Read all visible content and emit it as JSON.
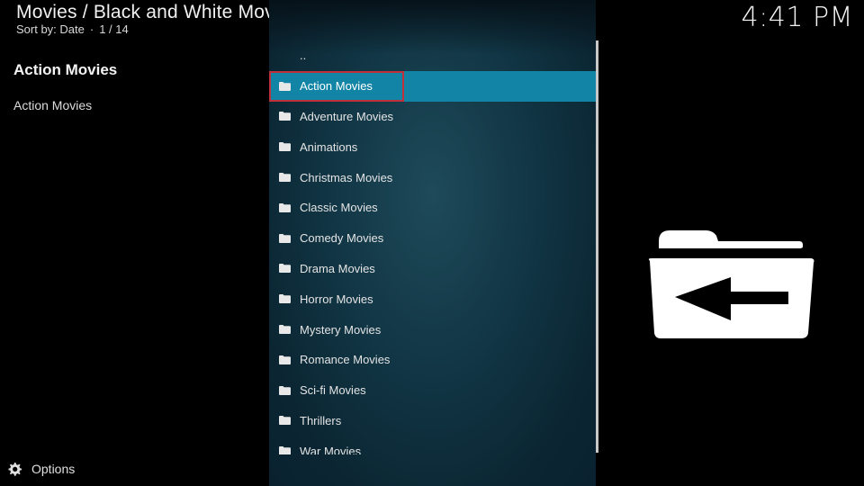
{
  "header": {
    "title": "Movies / Black and White Movies",
    "sort_label": "Sort by: Date",
    "separator": "·",
    "position": "1 / 14",
    "clock": "4:41 PM"
  },
  "info_panel": {
    "title": "Action Movies",
    "text": "Action Movies"
  },
  "list": {
    "parent_label": "..",
    "items": [
      {
        "label": "Action Movies",
        "selected": true
      },
      {
        "label": "Adventure Movies"
      },
      {
        "label": "Animations"
      },
      {
        "label": "Christmas Movies"
      },
      {
        "label": "Classic Movies"
      },
      {
        "label": "Comedy Movies"
      },
      {
        "label": "Drama Movies"
      },
      {
        "label": "Horror Movies"
      },
      {
        "label": "Mystery Movies"
      },
      {
        "label": "Romance Movies"
      },
      {
        "label": "Sci-fi Movies"
      },
      {
        "label": "Thrillers"
      },
      {
        "label": "War Movies"
      }
    ]
  },
  "footer": {
    "options_label": "Options"
  },
  "icons": {
    "folder": "folder-icon",
    "back": "folder-back-icon",
    "options": "gear-icon"
  },
  "colors": {
    "selection": "#1285a6",
    "focus_border": "#c0303a",
    "panel": "#113544"
  }
}
